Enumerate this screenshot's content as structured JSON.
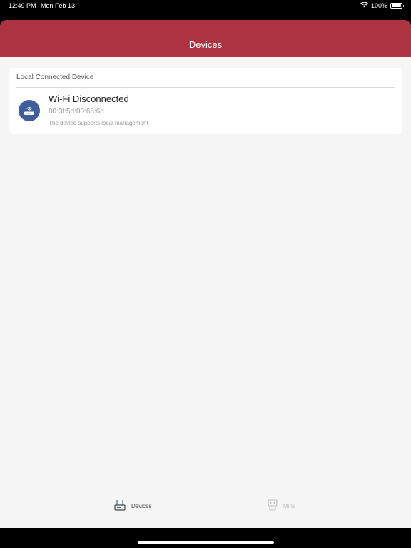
{
  "status_bar": {
    "time": "12:49 PM",
    "date": "Mon Feb 13",
    "battery": "100%"
  },
  "header": {
    "title": "Devices"
  },
  "card": {
    "title": "Local Connected Device",
    "device": {
      "name": "Wi-Fi Disconnected",
      "mac": "80:3f:5d:00:66:6d",
      "description": "The device supports local management",
      "icon": "router-icon"
    }
  },
  "tabs": [
    {
      "label": "Devices",
      "icon": "router-tab-icon",
      "active": true
    },
    {
      "label": "Mine",
      "icon": "robot-icon",
      "active": false
    }
  ],
  "colors": {
    "accent": "#ad3340",
    "icon_bg": "#3f5f9c",
    "background": "#f5f5f5"
  }
}
